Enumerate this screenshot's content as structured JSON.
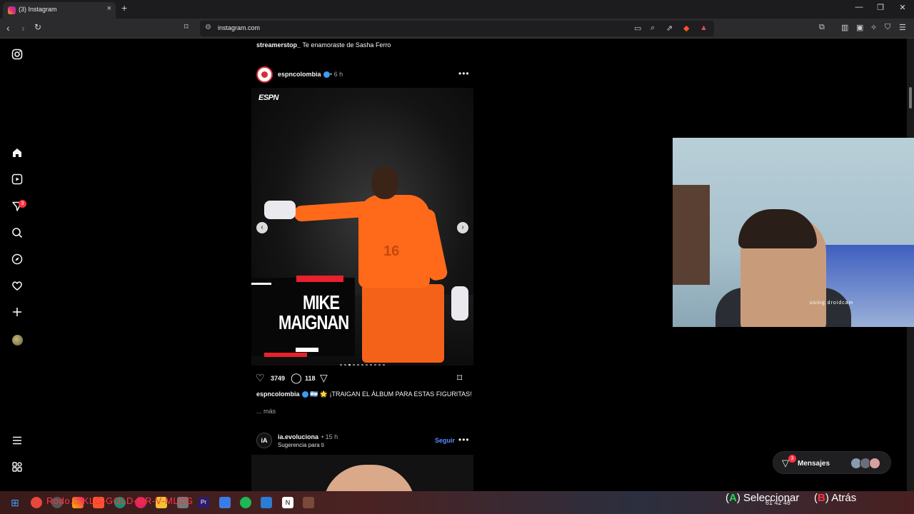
{
  "browser": {
    "tab_title": "(3) Instagram",
    "tab_close": "×",
    "new_tab": "+",
    "url": "instagram.com",
    "window_controls": [
      "—",
      "❐",
      "✕"
    ]
  },
  "nav": {
    "icons": [
      "instagram-logo-icon",
      "home-icon",
      "reels-icon",
      "direct-icon",
      "search-icon",
      "explore-icon",
      "heart-icon",
      "create-icon",
      "profile-avatar",
      "menu-icon",
      "threads-icon"
    ],
    "direct_badge": "3"
  },
  "feed": {
    "prev_caption_user": "streamerstop_",
    "prev_caption_text": "Te enamoraste de Sasha Ferro",
    "post": {
      "username": "espncolombia",
      "time": "• 6 h",
      "media": {
        "logo": "ESPN",
        "name_line1": "MIKE",
        "name_line2": "MAIGNAN",
        "jersey_number": "16",
        "carousel_dots": 11,
        "active_dot": 2
      },
      "likes": "3749",
      "comments": "118",
      "caption_user": "espncolombia",
      "caption_text": "🇦🇷 🌟 ¡TRAIGAN EL ÁLBUM PARA ESTAS FIGURITAS!",
      "more": "... más"
    },
    "next_post": {
      "avatar_text": "iA",
      "username": "ia.evoluciona",
      "time": "• 15 h",
      "subtitle": "Sugerencia para ti",
      "follow": "Seguir"
    }
  },
  "webcam": {
    "watermark": "using droidcam"
  },
  "messages": {
    "label": "Mensajes",
    "badge": "3"
  },
  "taskbar": {
    "overlay_text": "Rodo… KLG-GOLD-MR-V-MLCG",
    "select_key": "A",
    "select_label": "Seleccionar",
    "back_key": "B",
    "back_label": "Atrás",
    "tray_numbers": "61  42  48"
  },
  "colors": {
    "background": "#000000",
    "link_blue": "#5c8cff",
    "badge_red": "#ff3040",
    "espn_red": "#e8212d",
    "jersey_orange": "#ff6a1a"
  }
}
